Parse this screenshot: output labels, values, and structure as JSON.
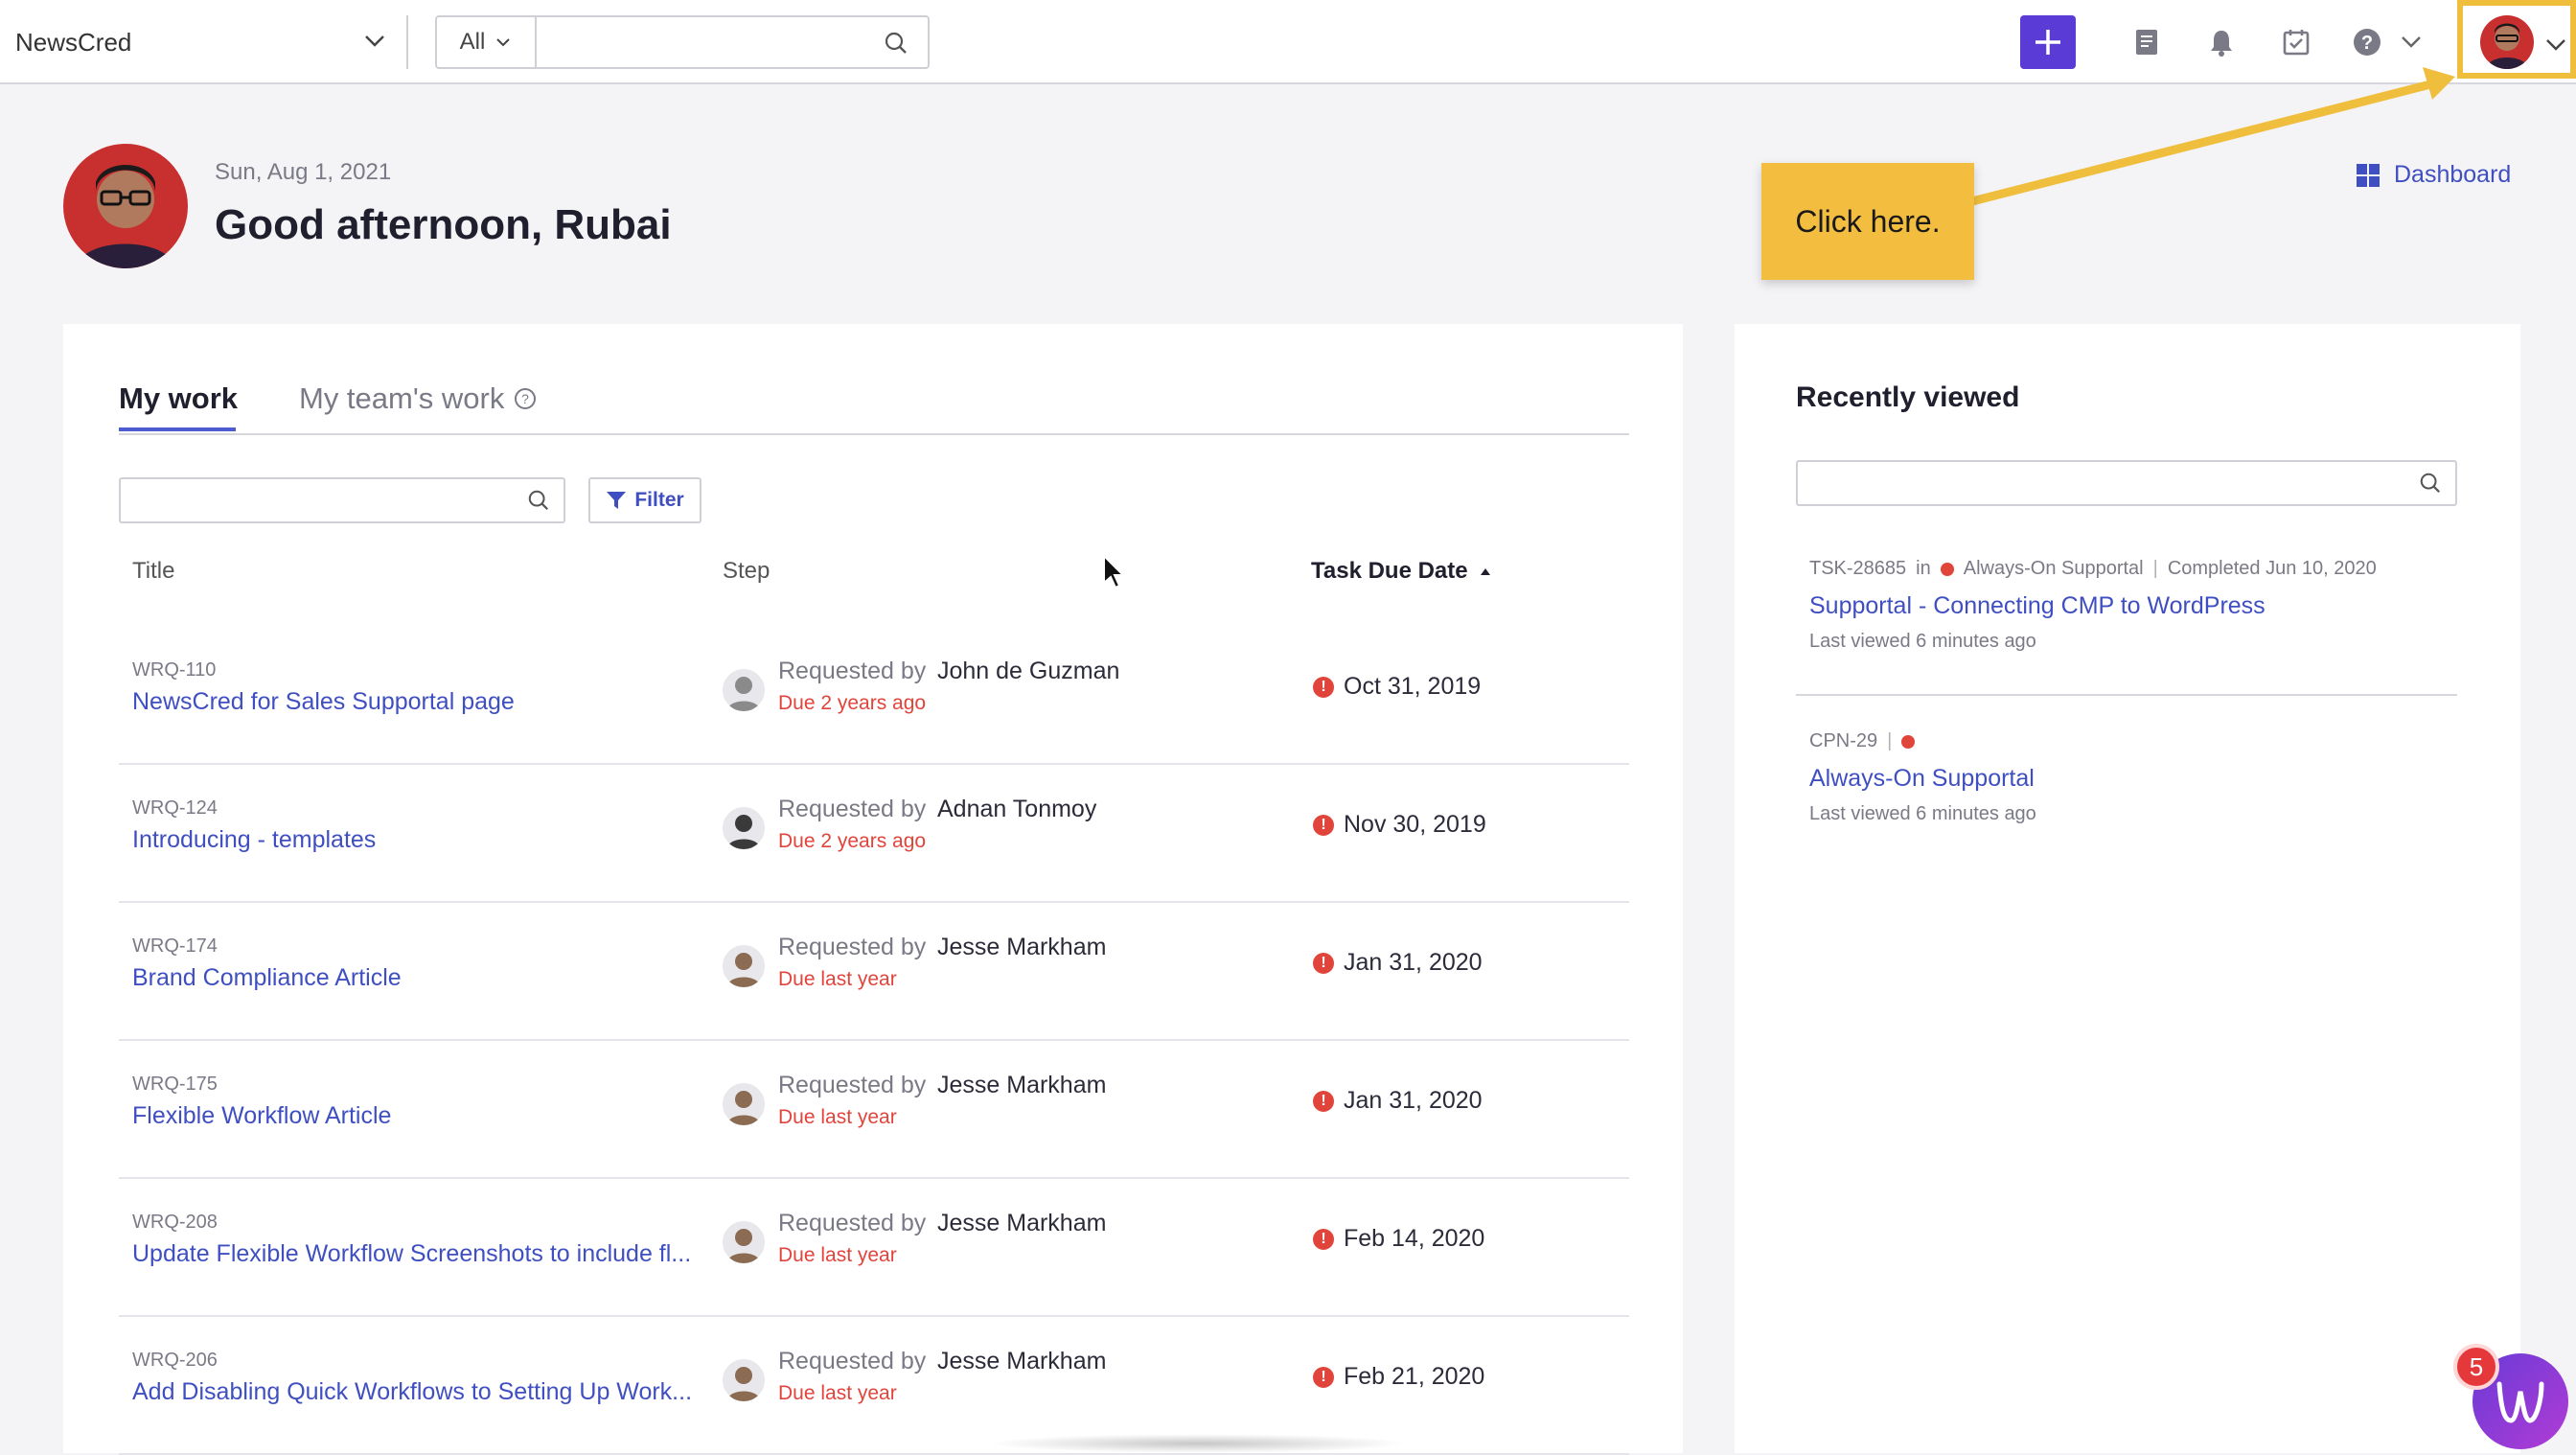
{
  "topbar": {
    "org_name": "NewsCred",
    "scope_label": "All",
    "search_value": "",
    "accent": "#5b3bd6"
  },
  "greeting": {
    "date": "Sun, Aug 1, 2021",
    "text": "Good afternoon, Rubai",
    "dashboard_label": "Dashboard"
  },
  "callout": {
    "text": "Click here."
  },
  "work": {
    "tabs": [
      {
        "label": "My work"
      },
      {
        "label": "My team's work"
      }
    ],
    "search_value": "",
    "filter_label": "Filter",
    "columns": {
      "title": "Title",
      "step": "Step",
      "due": "Task Due Date"
    },
    "rows": [
      {
        "id": "WRQ-110",
        "title": "NewsCred for Sales Supportal page",
        "requested_by": "Requested by",
        "name": "John de Guzman",
        "status": "Due 2 years ago",
        "due": "Oct 31, 2019"
      },
      {
        "id": "WRQ-124",
        "title": "Introducing - templates",
        "requested_by": "Requested by",
        "name": "Adnan Tonmoy",
        "status": "Due 2 years ago",
        "due": "Nov 30, 2019"
      },
      {
        "id": "WRQ-174",
        "title": "Brand Compliance Article",
        "requested_by": "Requested by",
        "name": "Jesse Markham",
        "status": "Due last year",
        "due": "Jan 31, 2020"
      },
      {
        "id": "WRQ-175",
        "title": "Flexible Workflow Article",
        "requested_by": "Requested by",
        "name": "Jesse Markham",
        "status": "Due last year",
        "due": "Jan 31, 2020"
      },
      {
        "id": "WRQ-208",
        "title": "Update Flexible Workflow Screenshots to include fl...",
        "requested_by": "Requested by",
        "name": "Jesse Markham",
        "status": "Due last year",
        "due": "Feb 14, 2020"
      },
      {
        "id": "WRQ-206",
        "title": "Add Disabling Quick Workflows to Setting Up Work...",
        "requested_by": "Requested by",
        "name": "Jesse Markham",
        "status": "Due last year",
        "due": "Feb 21, 2020"
      }
    ]
  },
  "recent": {
    "title": "Recently viewed",
    "search_value": "",
    "items": [
      {
        "id": "TSK-28685",
        "in": "in",
        "project": "Always-On Supportal",
        "completed": "Completed Jun 10, 2020",
        "title": "Supportal - Connecting CMP to WordPress",
        "last_viewed": "Last viewed 6 minutes ago"
      },
      {
        "id": "CPN-29",
        "title": "Always-On Supportal",
        "last_viewed": "Last viewed 6 minutes ago"
      }
    ]
  },
  "widget": {
    "badge_count": "5"
  },
  "colors": {
    "link": "#3f4fc1",
    "overdue": "#e0443b",
    "callout": "#f3be3f"
  }
}
